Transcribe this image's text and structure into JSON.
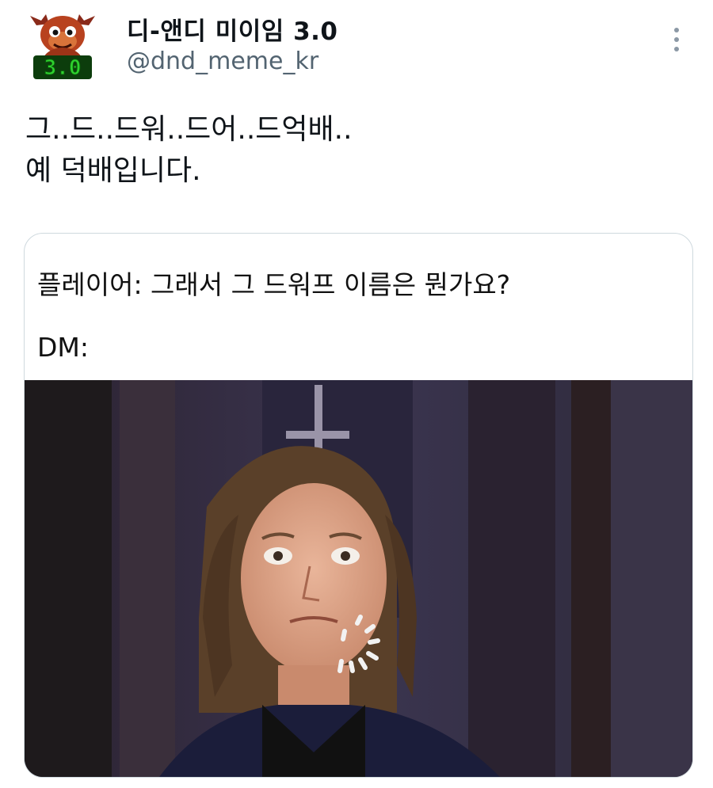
{
  "account": {
    "display_name": "디-앤디 미이임 3.0",
    "handle": "@dnd_meme_kr",
    "avatar_badge": "3.0",
    "avatar_icon": "dragon-mascot-avatar"
  },
  "tweet": {
    "text": "그..드..드워..드어..드억배..\n예 덕배입니다."
  },
  "quoted_media": {
    "caption_lines": [
      "플레이어: 그래서 그 드워프 이름은 뭔가요?",
      "DM:"
    ],
    "image": "reaction-photo-man-long-hair-startled"
  },
  "icons": {
    "more": "more-options-icon",
    "loading": "loading-spinner-icon"
  },
  "colors": {
    "text_primary": "#0f1419",
    "text_secondary": "#536471",
    "card_border": "#cfd9de",
    "avatar_badge_green": "#2fd22f"
  }
}
